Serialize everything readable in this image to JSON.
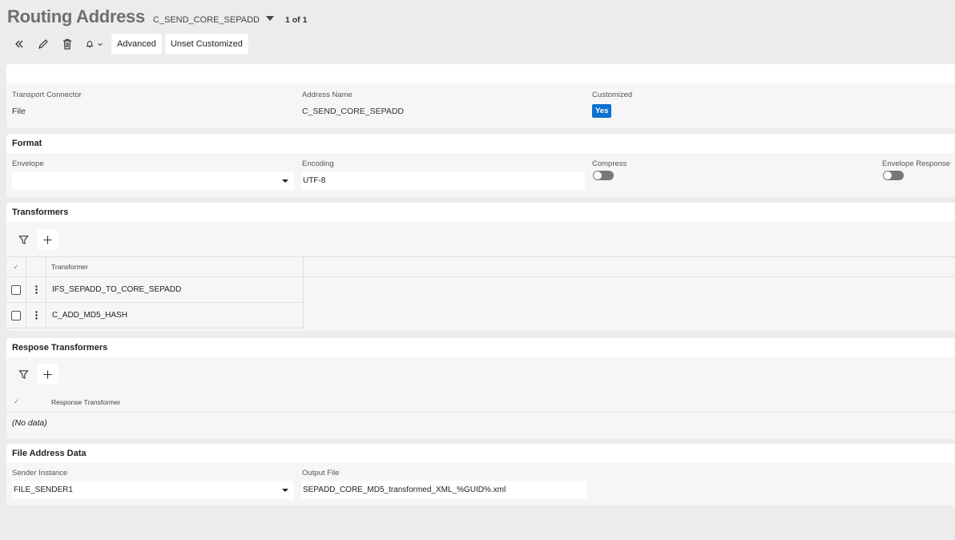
{
  "header": {
    "title": "Routing Address",
    "record_key": "C_SEND_CORE_SEPADD",
    "record_count": "1 of 1"
  },
  "toolbar": {
    "icons": [
      "collapse-icon",
      "edit-icon",
      "delete-icon",
      "bell-icon"
    ],
    "advanced_label": "Advanced",
    "unset_label": "Unset Customized"
  },
  "general": {
    "transport_connector_label": "Transport Connector",
    "transport_connector_value": "File",
    "address_name_label": "Address Name",
    "address_name_value": "C_SEND_CORE_SEPADD",
    "customized_label": "Customized",
    "customized_value": "Yes"
  },
  "format": {
    "title": "Format",
    "envelope_label": "Envelope",
    "envelope_value": "",
    "encoding_label": "Encoding",
    "encoding_value": "UTF-8",
    "compress_label": "Compress",
    "compress_on": false,
    "envelope_response_label": "Envelope Response",
    "envelope_response_on": false
  },
  "transformers": {
    "title": "Transformers",
    "column": "Transformer",
    "header_check": "✓",
    "rows": [
      "IFS_SEPADD_TO_CORE_SEPADD",
      "C_ADD_MD5_HASH"
    ]
  },
  "response_transformers": {
    "title": "Respose Transformers",
    "column": "Response Transformer",
    "header_check": "✓",
    "empty_text": "(No data)"
  },
  "file_address": {
    "title": "File Address Data",
    "sender_instance_label": "Sender Instance",
    "sender_instance_value": "FILE_SENDER1",
    "output_file_label": "Output File",
    "output_file_value": "SEPADD_CORE_MD5_transformed_XML_%GUID%.xml"
  },
  "colors": {
    "accent": "#0b72cf",
    "toggle_off": "#777777"
  }
}
